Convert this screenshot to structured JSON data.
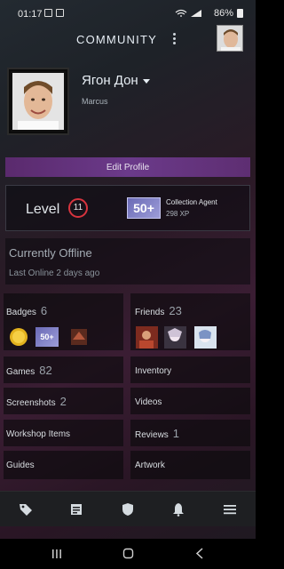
{
  "status_bar": {
    "time": "01:17",
    "battery": "86%"
  },
  "header": {
    "title": "COMMUNITY"
  },
  "profile": {
    "name": "Ягон Дон",
    "subtitle": "Marcus"
  },
  "edit_profile": {
    "label": "Edit Profile"
  },
  "level": {
    "label": "Level",
    "number": "11",
    "badge_text": "50+",
    "badge_title": "Collection Agent",
    "badge_xp": "298 XP"
  },
  "status": {
    "title": "Currently Offline",
    "last_online": "Last Online 2 days ago"
  },
  "tiles": {
    "badges": {
      "label": "Badges",
      "count": "6"
    },
    "friends": {
      "label": "Friends",
      "count": "23"
    },
    "games": {
      "label": "Games",
      "count": "82"
    },
    "inventory": {
      "label": "Inventory"
    },
    "screenshots": {
      "label": "Screenshots",
      "count": "2"
    },
    "videos": {
      "label": "Videos"
    },
    "workshop": {
      "label": "Workshop Items"
    },
    "reviews": {
      "label": "Reviews",
      "count": "1"
    },
    "guides": {
      "label": "Guides"
    },
    "artwork": {
      "label": "Artwork"
    }
  },
  "badges_preview": {
    "middle_badge_text": "50+"
  },
  "nav": [
    "tag-icon",
    "news-icon",
    "shield-icon",
    "bell-icon",
    "menu-icon"
  ],
  "colors": {
    "accent_purple": "#6b3a8a",
    "level_red": "#d7343e"
  }
}
